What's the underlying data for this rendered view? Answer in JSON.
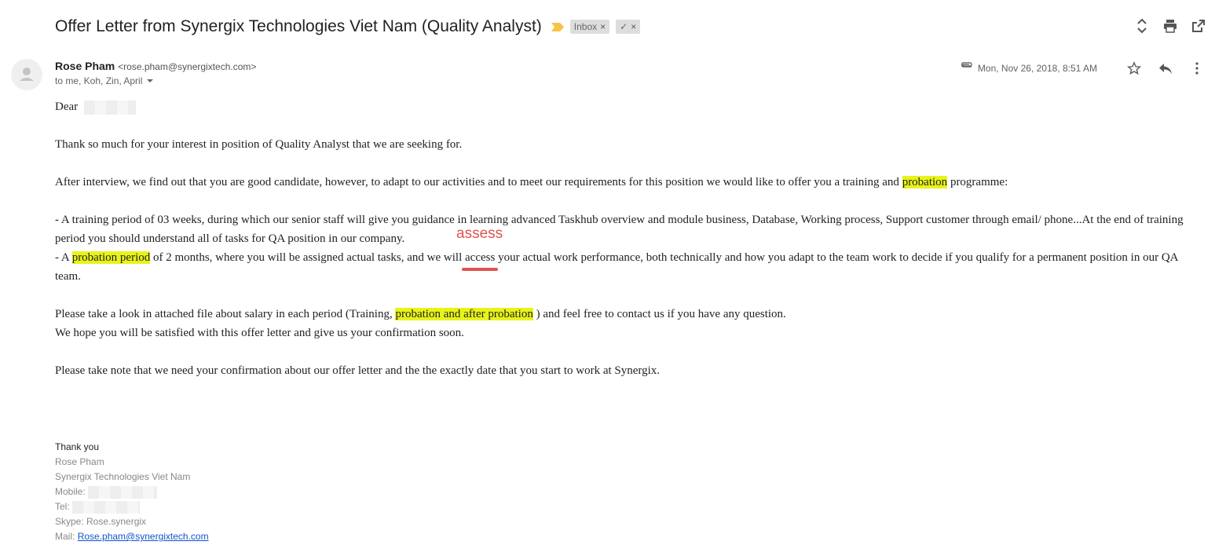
{
  "header": {
    "subject": "Offer Letter from Synergix Technologies Viet Nam (Quality Analyst)",
    "labels": [
      {
        "text": "Inbox",
        "close": "×"
      },
      {
        "text": "✓",
        "close": "×"
      }
    ],
    "importance_color": "#f6c344"
  },
  "toolbar": {
    "icons": [
      "expand-collapse-icon",
      "print-icon",
      "open-in-new-window-icon"
    ]
  },
  "message": {
    "sender_name": "Rose Pham",
    "sender_email": "<rose.pham@synergixtech.com>",
    "recipients": "to me, Koh, Zin, April",
    "date": "Mon, Nov 26, 2018, 8:51 AM",
    "meta_icons": [
      "attachment-icon",
      "star-icon",
      "reply-icon",
      "more-options-icon"
    ]
  },
  "body": {
    "greeting": "Dear",
    "p1": "Thank so much for your interest in position of Quality Analyst that we are seeking for.",
    "p2": {
      "before": "After interview, we find out that you are good candidate, however, to adapt to our activities and to meet our requirements for this position we would like to offer you a training and ",
      "highlight": "probation",
      "after": " programme:"
    },
    "bullet1": "- A training period of 03 weeks, during which our senior staff will give you guidance in learning advanced Taskhub overview and module business, Database, Working process, Support customer through email/ phone...At the end of training period you should understand all of tasks for QA position in our company.",
    "bullet2": {
      "prefix": " - A ",
      "highlight": "probation period",
      "mid": " of 2 months, where you will be assigned actual tasks, and we will ",
      "word": "access",
      "correction": "assess",
      "after": " your actual work performance, both technically and how you adapt to the team work to decide if you qualify for a permanent position in our QA team."
    },
    "p3": {
      "before": "Please take a look in attached file  about salary in each period (Training, ",
      "highlight": "probation and after probation",
      "after": " ) and feel free to contact us if you have any question."
    },
    "p4": "We hope you will be satisfied with this offer letter and give us your confirmation soon.",
    "p5": "Please take note that we need your confirmation about our offer letter and the the exactly date that you start to work at Synergix.",
    "highlight_color": "#e8f31a",
    "correction_color": "#e05353"
  },
  "signature": {
    "thanks": "Thank you",
    "name": "Rose Pham",
    "company": "Synergix Technologies Viet Nam",
    "mobile_label": "Mobile:",
    "tel_label": "Tel:",
    "skype": "Skype: Rose.synergix",
    "mail_label": "Mail:",
    "mail_link": "Rose.pham@synergixtech.com"
  }
}
